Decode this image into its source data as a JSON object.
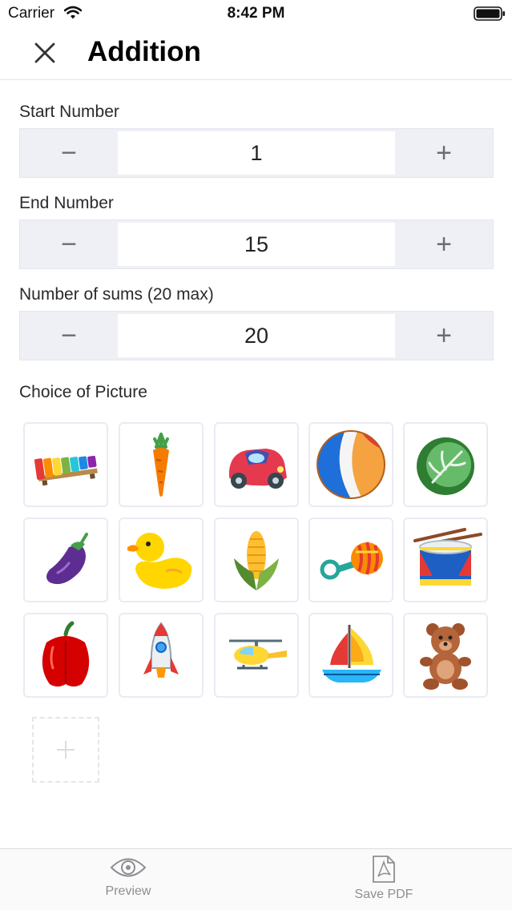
{
  "status_bar": {
    "carrier": "Carrier",
    "time": "8:42 PM",
    "icons": [
      "wifi-icon",
      "battery-icon"
    ]
  },
  "nav": {
    "title": "Addition",
    "close_icon": "close-icon"
  },
  "fields": [
    {
      "label": "Start Number",
      "value": "1",
      "minus": "−",
      "plus": "+"
    },
    {
      "label": "End Number",
      "value": "15",
      "minus": "−",
      "plus": "+"
    },
    {
      "label": "Number of sums (20 max)",
      "value": "20",
      "minus": "−",
      "plus": "+"
    }
  ],
  "pictures": {
    "label": "Choice of Picture",
    "items": [
      "xylophone-icon",
      "carrot-icon",
      "toy-car-icon",
      "beach-ball-icon",
      "cabbage-icon",
      "eggplant-icon",
      "rubber-duck-icon",
      "corn-icon",
      "rattle-icon",
      "drum-icon",
      "bell-pepper-icon",
      "rocket-icon",
      "helicopter-icon",
      "sailboat-icon",
      "teddy-bear-icon"
    ],
    "add_symbol": "+"
  },
  "toolbar": {
    "preview_label": "Preview",
    "save_label": "Save PDF"
  },
  "colors": {
    "stepper_bg": "#eef0f5",
    "toolbar_text": "#8e8e93"
  }
}
